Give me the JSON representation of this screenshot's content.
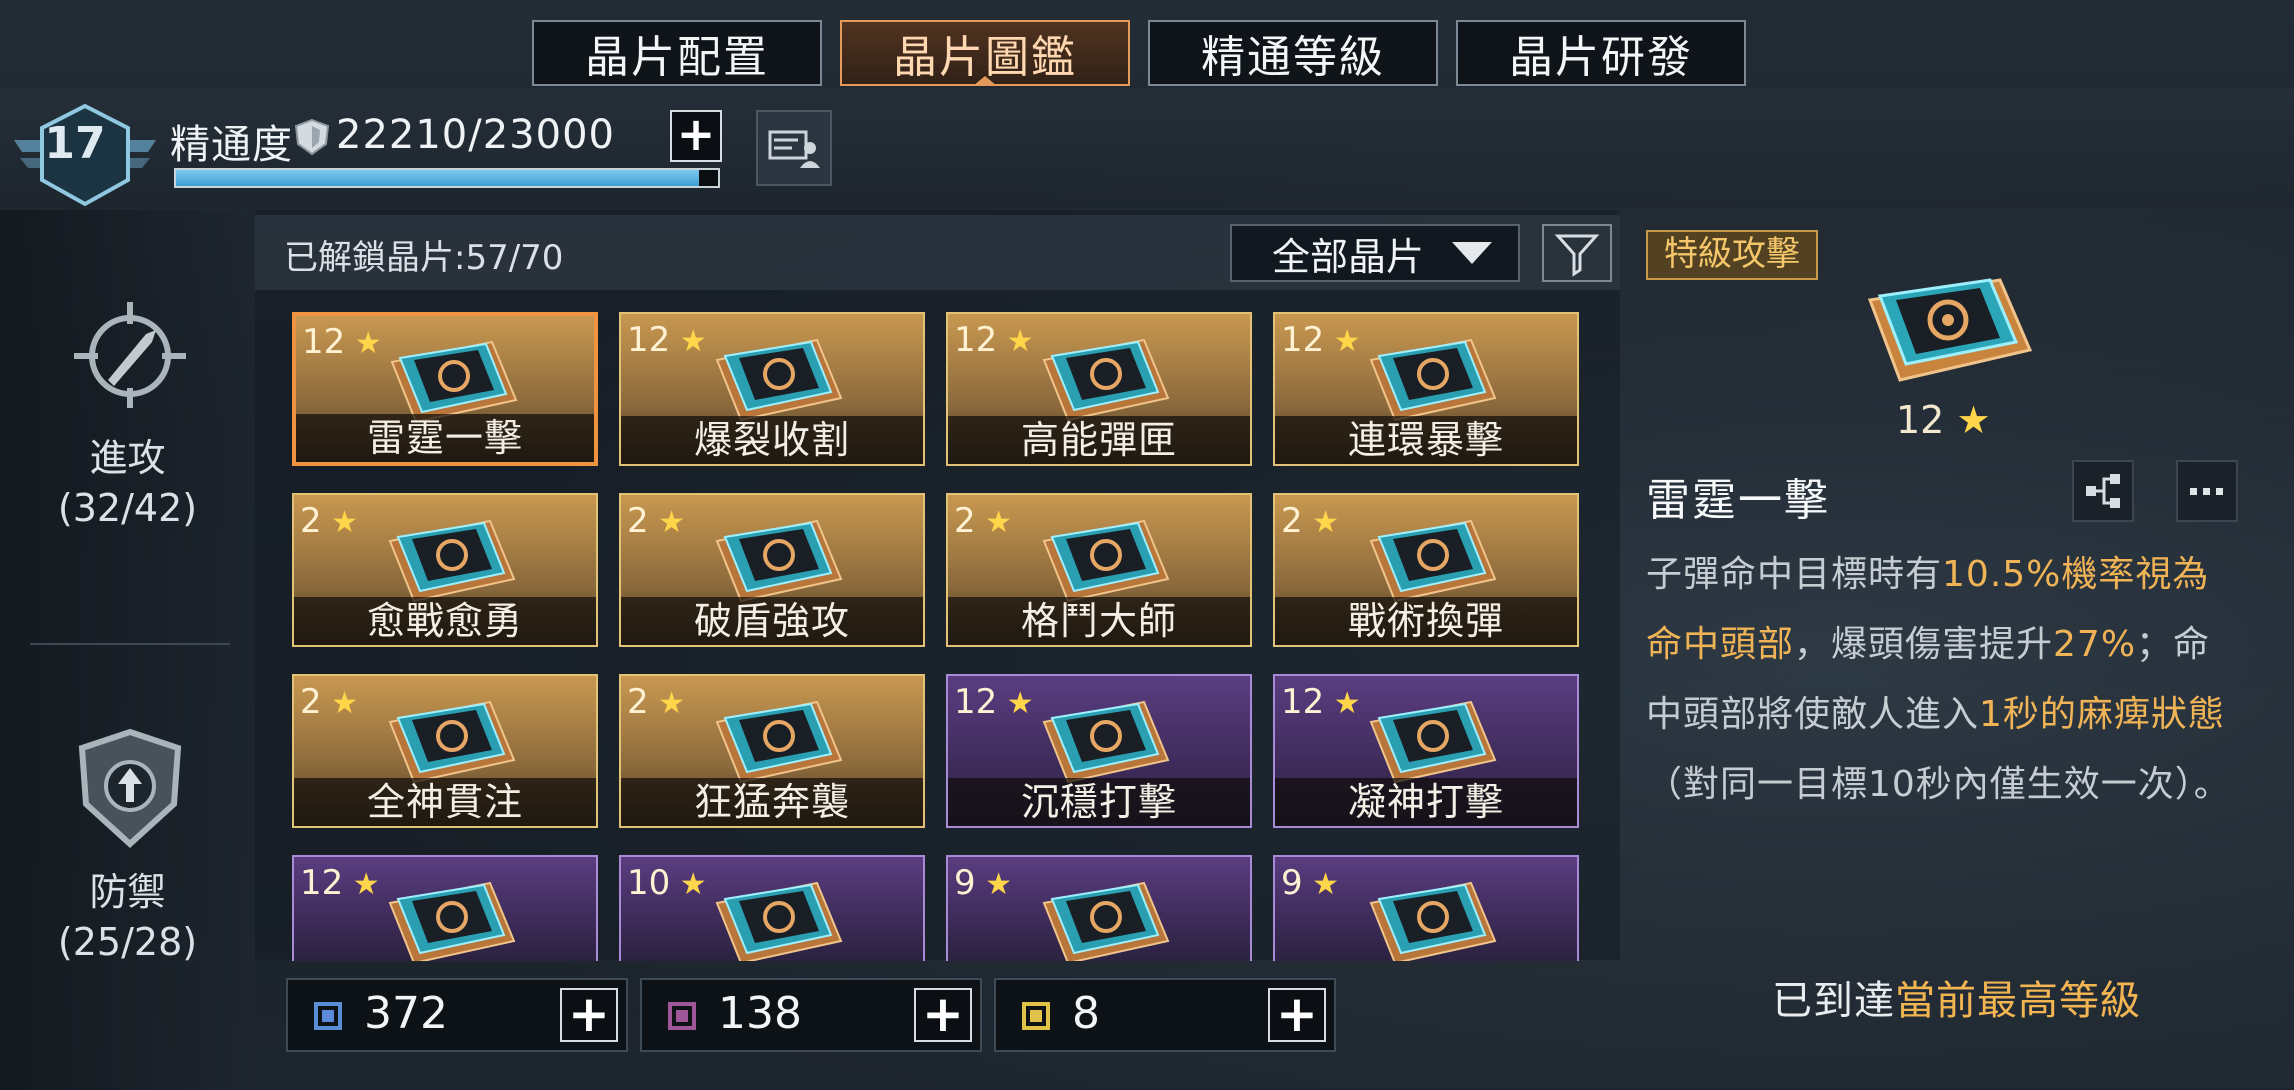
{
  "tabs": [
    {
      "label": "晶片配置",
      "active": false
    },
    {
      "label": "晶片圖鑑",
      "active": true
    },
    {
      "label": "精通等級",
      "active": false
    },
    {
      "label": "晶片研發",
      "active": false
    }
  ],
  "header": {
    "level": "17",
    "mastery_label": "精通度",
    "mastery_value": "22210/23000",
    "mastery_progress": 0.9657
  },
  "sidebar": {
    "attack_label": "進攻",
    "attack_count": "(32/42)",
    "defense_label": "防禦",
    "defense_count": "(25/28)"
  },
  "list": {
    "unlocked": "已解鎖晶片:57/70",
    "filter_value": "全部晶片",
    "chips": [
      {
        "stars": "12",
        "name": "雷霆一擊",
        "tier": "gold",
        "selected": true
      },
      {
        "stars": "12",
        "name": "爆裂收割",
        "tier": "gold"
      },
      {
        "stars": "12",
        "name": "高能彈匣",
        "tier": "gold"
      },
      {
        "stars": "12",
        "name": "連環暴擊",
        "tier": "gold"
      },
      {
        "stars": "2",
        "name": "愈戰愈勇",
        "tier": "gold"
      },
      {
        "stars": "2",
        "name": "破盾強攻",
        "tier": "gold"
      },
      {
        "stars": "2",
        "name": "格鬥大師",
        "tier": "gold"
      },
      {
        "stars": "2",
        "name": "戰術換彈",
        "tier": "gold"
      },
      {
        "stars": "2",
        "name": "全神貫注",
        "tier": "gold"
      },
      {
        "stars": "2",
        "name": "狂猛奔襲",
        "tier": "gold"
      },
      {
        "stars": "12",
        "name": "沉穩打擊",
        "tier": "purple"
      },
      {
        "stars": "12",
        "name": "凝神打擊",
        "tier": "purple"
      },
      {
        "stars": "12",
        "name": "",
        "tier": "purple"
      },
      {
        "stars": "10",
        "name": "",
        "tier": "purple"
      },
      {
        "stars": "9",
        "name": "",
        "tier": "purple"
      },
      {
        "stars": "9",
        "name": "",
        "tier": "purple"
      }
    ]
  },
  "currency": [
    {
      "value": "372",
      "color": "#5a8cd8"
    },
    {
      "value": "138",
      "color": "#a0579a"
    },
    {
      "value": "8",
      "color": "#e0c24a"
    }
  ],
  "detail": {
    "tag": "特級攻擊",
    "stars": "12",
    "name": "雷霆一擊",
    "desc_1": "子彈命中目標時有",
    "desc_hl_1": "10.5%機率視為命中頭部",
    "desc_2": "，爆頭傷害提升",
    "desc_hl_2": "27%",
    "desc_3": "；命中頭部將使敵人進入",
    "desc_hl_3": "1秒的麻痺狀態",
    "desc_4": "（對同一目標10秒內僅生效一次）。",
    "max_prefix": "已到達",
    "max_hl": "當前最高等級"
  }
}
